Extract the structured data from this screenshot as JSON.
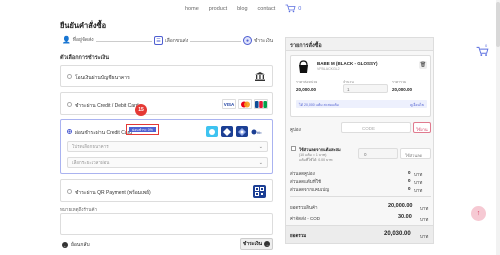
{
  "nav": {
    "items": [
      "home",
      "product",
      "blog",
      "contact"
    ],
    "cart_count": "0"
  },
  "page_title": "ยืนยันคำสั่งซื้อ",
  "steps": [
    {
      "label": "ที่อยู่จัดส่ง"
    },
    {
      "label": "เลือกขนส่ง"
    },
    {
      "label": "ชำระเงิน"
    }
  ],
  "payment_section_label": "ตัวเลือกการชำระเงิน",
  "payment_options": [
    {
      "label": "โอนเงินผ่านบัญชีธนาคาร"
    },
    {
      "label": "ชำระผ่าน Credit / Debit Card"
    },
    {
      "label": "ผ่อนชำระผ่าน Credit Card",
      "badge": "ผ่อนชำระ 0%"
    },
    {
      "label": "ชำระผ่าน QR Payment (พร้อมเพย์)"
    }
  ],
  "card_logos": [
    "VISA",
    "MC",
    "JCB"
  ],
  "installment": {
    "bank_placeholder": "โปรดเลือกธนาคาร",
    "term_placeholder": "เลือกระยะเวลาผ่อน"
  },
  "annotation_number": "15",
  "note_label": "หมายเหตุถึงร้านค้า",
  "back_label": "ย้อนกลับ",
  "next_label": "ชำระเงิน",
  "summary": {
    "title": "รายการสั่งซื้อ",
    "product_name": "BABE M (BLACK - GLOSSY)",
    "product_sku": "VFBLACKGL2",
    "col_price": "ราคาต่อหน่วย",
    "col_qty": "จำนวน",
    "col_total": "ราคารวม",
    "unit_price": "20,000.00",
    "qty": "1",
    "line_total": "20,000.00",
    "points_note": "ได้ 20,000 แต้ม สะสมแต้ม",
    "points_link": "ดูเงื่อนไข",
    "coupon_label": "คูปอง",
    "coupon_placeholder": "CODE",
    "coupon_button": "ใช้งาน",
    "use_points_label": "ใช้ส่วนลดจากแต้มสะสม",
    "use_points_sub": "(10 แต้ม = 1 บาท)",
    "use_points_avail": "แต้มที่ใช้ได้: 0.00 บาท",
    "points_input": "0",
    "points_button": "ใช้ส่วนลด",
    "rows": [
      {
        "label": "ส่วนลดคูปอง",
        "value": "0",
        "unit": "บาท"
      },
      {
        "label": "ส่วนลดแต้มที่ใช้",
        "value": "0",
        "unit": "บาท"
      },
      {
        "label": "ส่วนลดจากแคมเปญ",
        "value": "0",
        "unit": "บาท"
      }
    ],
    "subtotal_label": "ยอดรวมสินค้า",
    "subtotal_value": "20,000.00",
    "shipping_label": "ค่าจัดส่ง - COD",
    "shipping_value": "30.00",
    "total_label": "ยอดรวม",
    "total_value": "20,030.00",
    "currency": "บาท"
  },
  "side_cart_count": "0"
}
